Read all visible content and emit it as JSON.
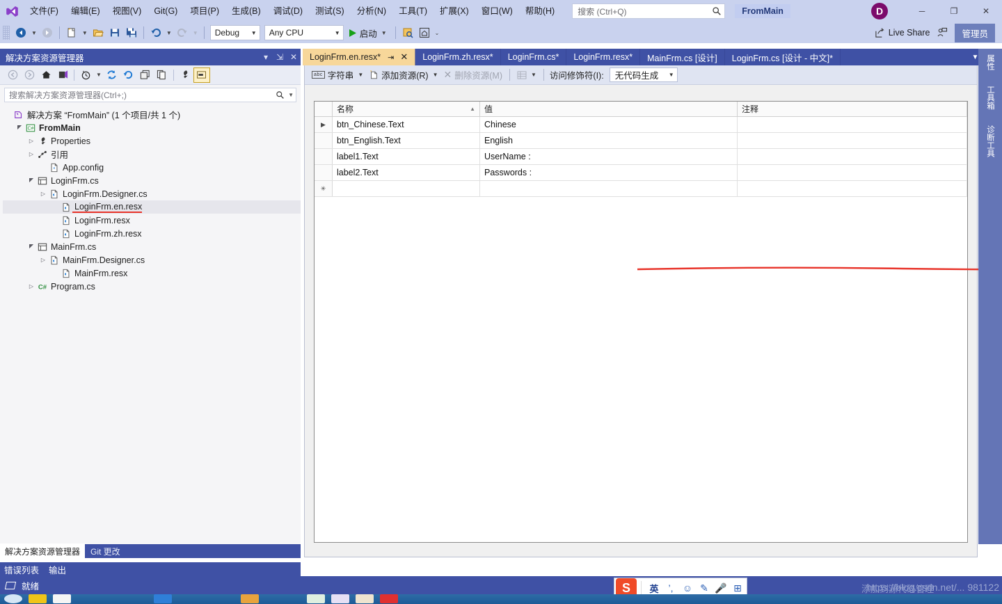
{
  "titlebar": {
    "logo_icon": "visual-studio-logo",
    "menus": [
      {
        "label": "文件(F)"
      },
      {
        "label": "编辑(E)"
      },
      {
        "label": "视图(V)"
      },
      {
        "label": "Git(G)"
      },
      {
        "label": "项目(P)"
      },
      {
        "label": "生成(B)"
      },
      {
        "label": "调试(D)"
      },
      {
        "label": "测试(S)"
      },
      {
        "label": "分析(N)"
      },
      {
        "label": "工具(T)"
      },
      {
        "label": "扩展(X)"
      },
      {
        "label": "窗口(W)"
      },
      {
        "label": "帮助(H)"
      }
    ],
    "search": {
      "placeholder": "搜索 (Ctrl+Q)",
      "value": "",
      "icon": "search-icon"
    },
    "project_chip": "FromMain",
    "account_initial": "D",
    "window_buttons": {
      "minimize": "─",
      "maximize": "❐",
      "close": "✕"
    }
  },
  "toolbar": {
    "back_icon": "navigate-back-icon",
    "forward_icon": "navigate-forward-icon",
    "new_project_icon": "new-project-icon",
    "open_file_icon": "open-file-icon",
    "save_icon": "save-icon",
    "save_all_icon": "save-all-icon",
    "undo_icon": "undo-icon",
    "redo_icon": "redo-icon",
    "configuration": "Debug",
    "platform": "Any CPU",
    "run_label": "启动",
    "run_icon": "play-icon",
    "preview_icon": "preview-changes-icon",
    "home_icon": "home-panel-icon",
    "live_share": "Live Share",
    "live_share_icon": "live-share-icon",
    "feedback_icon": "feedback-icon",
    "admin": "管理员"
  },
  "solution_explorer": {
    "title": "解决方案资源管理器",
    "header_icons": [
      "chevron-down-icon",
      "pin-icon",
      "close-icon"
    ],
    "toolbar_icons": [
      "back-icon",
      "forward-icon",
      "home-icon",
      "pending-changes-icon",
      "view-history-icon",
      "refresh-icon",
      "sync-icon",
      "collapse-all-icon",
      "show-all-files-icon",
      "properties-icon",
      "preview-selected-items-icon"
    ],
    "search": {
      "placeholder": "搜索解决方案资源管理器(Ctrl+;)",
      "value": "",
      "icon": "search-icon"
    },
    "tree": [
      {
        "label": "解决方案 “FromMain” (1 个项目/共 1 个)",
        "indent": 0,
        "arrow": "none",
        "icon": "solution-icon",
        "bold": false,
        "selected": false
      },
      {
        "label": "FromMain",
        "indent": 1,
        "arrow": "expanded",
        "icon": "csharp-project-icon",
        "bold": true,
        "selected": false
      },
      {
        "label": "Properties",
        "indent": 2,
        "arrow": "collapsed",
        "icon": "properties-folder-icon",
        "bold": false,
        "selected": false
      },
      {
        "label": "引用",
        "indent": 2,
        "arrow": "collapsed",
        "icon": "references-icon",
        "bold": false,
        "selected": false
      },
      {
        "label": "App.config",
        "indent": 3,
        "arrow": "none",
        "icon": "config-file-icon",
        "bold": false,
        "selected": false
      },
      {
        "label": "LoginFrm.cs",
        "indent": 2,
        "arrow": "expanded",
        "icon": "form-icon",
        "bold": false,
        "selected": false
      },
      {
        "label": "LoginFrm.Designer.cs",
        "indent": 3,
        "arrow": "collapsed",
        "icon": "cs-file-icon",
        "bold": false,
        "selected": false
      },
      {
        "label": "LoginFrm.en.resx",
        "indent": 4,
        "arrow": "none",
        "icon": "resx-file-icon",
        "bold": false,
        "selected": true
      },
      {
        "label": "LoginFrm.resx",
        "indent": 4,
        "arrow": "none",
        "icon": "resx-file-icon",
        "bold": false,
        "selected": false
      },
      {
        "label": "LoginFrm.zh.resx",
        "indent": 4,
        "arrow": "none",
        "icon": "resx-file-icon",
        "bold": false,
        "selected": false
      },
      {
        "label": "MainFrm.cs",
        "indent": 2,
        "arrow": "expanded",
        "icon": "form-icon",
        "bold": false,
        "selected": false
      },
      {
        "label": "MainFrm.Designer.cs",
        "indent": 3,
        "arrow": "collapsed",
        "icon": "cs-file-icon",
        "bold": false,
        "selected": false
      },
      {
        "label": "MainFrm.resx",
        "indent": 4,
        "arrow": "none",
        "icon": "resx-file-icon",
        "bold": false,
        "selected": false
      },
      {
        "label": "Program.cs",
        "indent": 2,
        "arrow": "collapsed",
        "icon": "csharp-file-icon",
        "bold": false,
        "selected": false
      }
    ],
    "panel_tabs": [
      {
        "label": "解决方案资源管理器",
        "active": true
      },
      {
        "label": "Git 更改",
        "active": false
      }
    ],
    "lower_tabs": [
      {
        "label": "错误列表"
      },
      {
        "label": "输出"
      }
    ]
  },
  "editor": {
    "tabs": [
      {
        "label": "LoginFrm.en.resx*",
        "active": true
      },
      {
        "label": "LoginFrm.zh.resx*",
        "active": false
      },
      {
        "label": "LoginFrm.cs*",
        "active": false
      },
      {
        "label": "LoginFrm.resx*",
        "active": false
      },
      {
        "label": "MainFrm.cs [设计]",
        "active": false
      },
      {
        "label": "LoginFrm.cs [设计 - 中文]*",
        "active": false
      }
    ],
    "tab_pin_icon": "pin-icon",
    "tab_close_icon": "close-icon",
    "tabstrip_overflow_icon": "chevron-down-icon",
    "tabstrip_settings_icon": "gear-icon",
    "resx_toolbar": {
      "category_icon": "abc-string-icon",
      "category_label": "字符串",
      "add_resource_label": "添加资源(R)",
      "add_resource_icon": "add-resource-icon",
      "remove_resource_label": "删除资源(M)",
      "remove_resource_icon": "remove-resource-icon",
      "view_icon": "details-view-icon",
      "access_modifier_label": "访问修饰符(I):",
      "access_modifier_value": "无代码生成"
    },
    "grid": {
      "columns": [
        "名称",
        "值",
        "注释"
      ],
      "sort_column": "名称",
      "sort_direction": "asc",
      "rows": [
        {
          "name": "btn_Chinese.Text",
          "value": "Chinese",
          "comment": "",
          "current": true
        },
        {
          "name": "btn_English.Text",
          "value": "English",
          "comment": "",
          "current": false
        },
        {
          "name": "label1.Text",
          "value": "UserName :",
          "comment": "",
          "current": false
        },
        {
          "name": "label2.Text",
          "value": "Passwords :",
          "comment": "",
          "current": false
        },
        {
          "name": "",
          "value": "",
          "comment": "",
          "current": false,
          "new_row": true
        }
      ]
    },
    "annotation_color": "#e8342a"
  },
  "right_tabs": [
    {
      "label": "属性"
    },
    {
      "label": "工具箱"
    },
    {
      "label": "诊断工具"
    }
  ],
  "statusbar": {
    "icon": "ready-icon",
    "text": "就绪",
    "watermark": "https://blog.csdn.net/... 981122",
    "overlay_text": "添加到源代码管理"
  },
  "ime": {
    "logo": "S",
    "mode": "英",
    "punctuation_icon": "punctuation-icon",
    "emoji_icon": "emoji-icon",
    "pen_icon": "pen-icon",
    "mic_icon": "microphone-icon",
    "grid_icon": "apps-grid-icon"
  },
  "colors": {
    "accent": "#3f51a5",
    "chrome": "#c9d2ee",
    "active_tab": "#f7d79a",
    "annotation_red": "#e8342a",
    "admin_chip": "#6d7fbb"
  }
}
